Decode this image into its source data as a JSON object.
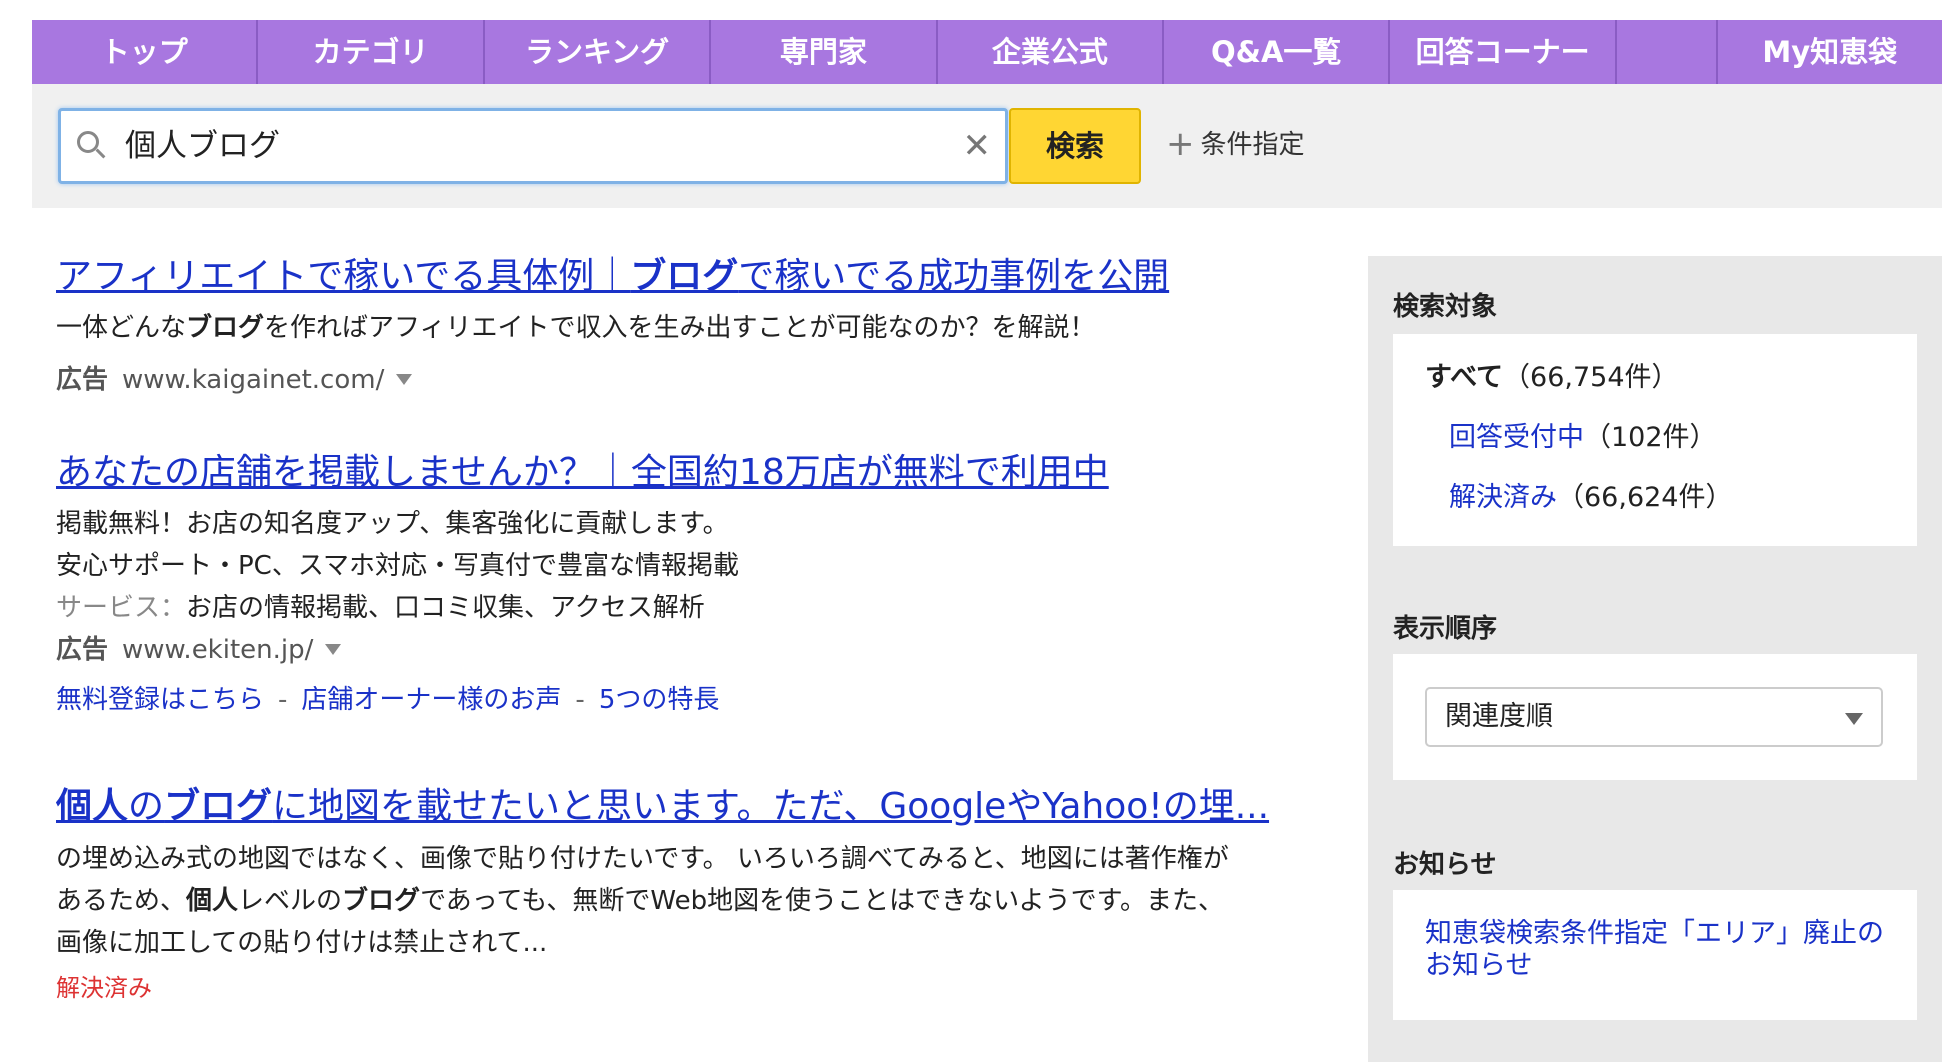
{
  "nav": {
    "items": [
      "トップ",
      "カテゴリ",
      "ランキング",
      "専門家",
      "企業公式",
      "Q&A一覧",
      "回答コーナー",
      "",
      "My知恵袋"
    ]
  },
  "search": {
    "query": "個人ブログ",
    "clear_label": "✕",
    "button_label": "検索",
    "conditions_label": "条件指定"
  },
  "results": [
    {
      "title_parts": [
        "アフィリエイトで稼いでる具体例｜",
        "ブログ",
        "で稼いでる成功事例を公開"
      ],
      "desc_parts": [
        "一体どんな",
        "ブログ",
        "を作ればアフィリエイトで収入を生み出すことが可能なのか？を解説！"
      ],
      "ad_label": "広告",
      "url": "www.kaigainet.com/"
    },
    {
      "title": "あなたの店舗を掲載しませんか？｜全国約18万店が無料で利用中",
      "desc_lines": [
        "掲載無料！お店の知名度アップ、集客強化に貢献します。",
        "安心サポート・PC、スマホ対応・写真付で豊富な情報掲載"
      ],
      "service_label": "サービス：",
      "service_text": "お店の情報掲載、口コミ収集、アクセス解析",
      "ad_label": "広告",
      "url": "www.ekiten.jp/",
      "sitelinks": [
        "無料登録はこちら",
        "店舗オーナー様のお声",
        "5つの特長"
      ],
      "sitelink_sep": "-"
    },
    {
      "title_parts": [
        "個人",
        "の",
        "ブログ",
        "に地図を載せたいと思います。ただ、GoogleやYahoo!の埋..."
      ],
      "desc_line1": "の埋め込み式の地図ではなく、画像で貼り付けたいです。 いろいろ調べてみると、地図には著作権が",
      "desc_line2_parts": [
        "あるため、",
        "個人",
        "レベルの",
        "ブログ",
        "であっても、無断でWeb地図を使うことはできないようです。また、"
      ],
      "desc_line3": "画像に加工しての貼り付けは禁止されて...",
      "status": "解決済み"
    }
  ],
  "sidebar": {
    "target_heading": "検索対象",
    "targets": [
      {
        "label": "すべて",
        "count": "（66,754件）"
      },
      {
        "label": "回答受付中",
        "count": "（102件）"
      },
      {
        "label": "解決済み",
        "count": "（66,624件）"
      }
    ],
    "order_heading": "表示順序",
    "order_selected": "関連度順",
    "notice_heading": "お知らせ",
    "notice_link": "知恵袋検索条件指定「エリア」廃止のお知らせ"
  }
}
